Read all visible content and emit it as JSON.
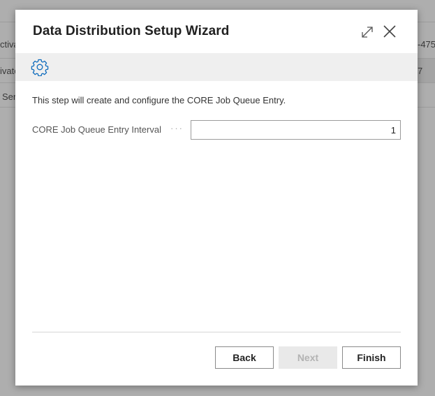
{
  "background": {
    "left_cells": [
      "ctiva",
      "ivate",
      "Ser"
    ],
    "right_cells": [
      "-475",
      "7"
    ]
  },
  "dialog": {
    "title": "Data Distribution Setup Wizard",
    "instruction": "This step will create and configure the CORE Job Queue Entry.",
    "field": {
      "label": "CORE Job Queue Entry Interval",
      "value": "1"
    },
    "buttons": {
      "back": "Back",
      "next": "Next",
      "finish": "Finish"
    }
  },
  "colors": {
    "accent": "#0f6cbd",
    "toolbar_bg": "#efefef"
  },
  "icons": {
    "expand": "expand-icon",
    "close": "close-icon",
    "settings": "gear-icon"
  }
}
